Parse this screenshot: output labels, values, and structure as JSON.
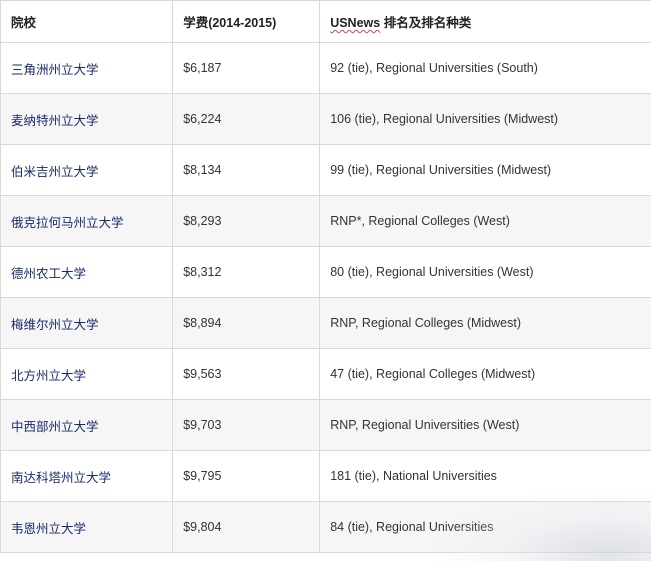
{
  "table": {
    "headers": {
      "school": "院校",
      "fee": "学费(2014-2015)",
      "rank_prefix": "USNews",
      "rank_suffix": " 排名及排名种类"
    },
    "rows": [
      {
        "school": "三角洲州立大学",
        "fee": "$6,187",
        "rank": "92 (tie), Regional Universities (South)"
      },
      {
        "school": "麦纳特州立大学",
        "fee": "$6,224",
        "rank": "106 (tie), Regional Universities (Midwest)"
      },
      {
        "school": "伯米吉州立大学",
        "fee": "$8,134",
        "rank": "99 (tie), Regional Universities (Midwest)"
      },
      {
        "school": "俄克拉何马州立大学",
        "fee": "$8,293",
        "rank": "RNP*, Regional Colleges (West)"
      },
      {
        "school": "德州农工大学",
        "fee": "$8,312",
        "rank": "80 (tie), Regional Universities (West)"
      },
      {
        "school": "梅维尔州立大学",
        "fee": "$8,894",
        "rank": "RNP, Regional Colleges (Midwest)"
      },
      {
        "school": "北方州立大学",
        "fee": "$9,563",
        "rank": "47 (tie), Regional Colleges (Midwest)"
      },
      {
        "school": "中西部州立大学",
        "fee": "$9,703",
        "rank": "RNP, Regional Universities (West)"
      },
      {
        "school": "南达科塔州立大学",
        "fee": "$9,795",
        "rank": "181 (tie), National Universities"
      },
      {
        "school": "韦恩州立大学",
        "fee": "$9,804",
        "rank": "84 (tie), Regional Universities"
      }
    ]
  }
}
